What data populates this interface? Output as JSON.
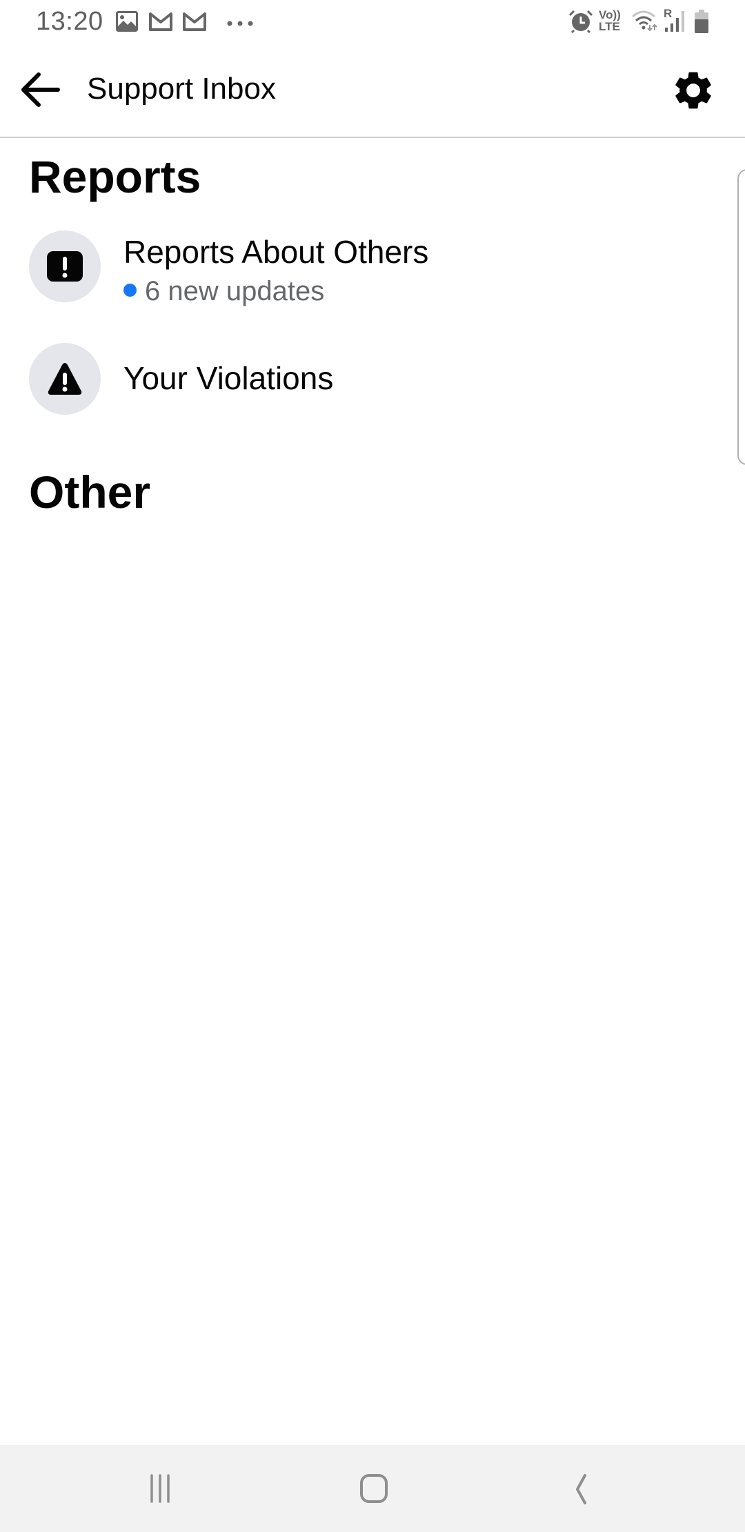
{
  "status_bar": {
    "time": "13:20",
    "left_icons": [
      "gallery-icon",
      "gmail-icon",
      "gmail-icon",
      "more-notifications-icon"
    ],
    "right_icons": [
      "alarm-icon",
      "volte-icon",
      "wifi-icon",
      "signal-roaming-icon",
      "battery-icon"
    ],
    "volte_label_top": "Vo))",
    "volte_label_bottom": "LTE",
    "roaming_label": "R"
  },
  "header": {
    "title": "Support Inbox",
    "back_icon": "arrow-left-icon",
    "settings_icon": "gear-icon"
  },
  "sections": [
    {
      "title": "Reports",
      "items": [
        {
          "label": "Reports About Others",
          "icon": "exclamation-square-icon",
          "subtitle": "6 new updates",
          "badge_color": "#1877f2"
        },
        {
          "label": "Your Violations",
          "icon": "warning-triangle-icon"
        }
      ]
    },
    {
      "title": "Other",
      "items": []
    }
  ],
  "nav_bar": {
    "buttons": [
      "recent-apps",
      "home",
      "back"
    ]
  },
  "colors": {
    "icon_circle_bg": "#e4e6eb",
    "primary_text": "#050505",
    "secondary_text": "#65676b",
    "unread_dot": "#1877f2",
    "divider": "#ced0d4",
    "nav_bar_bg": "#f2f2f2"
  }
}
